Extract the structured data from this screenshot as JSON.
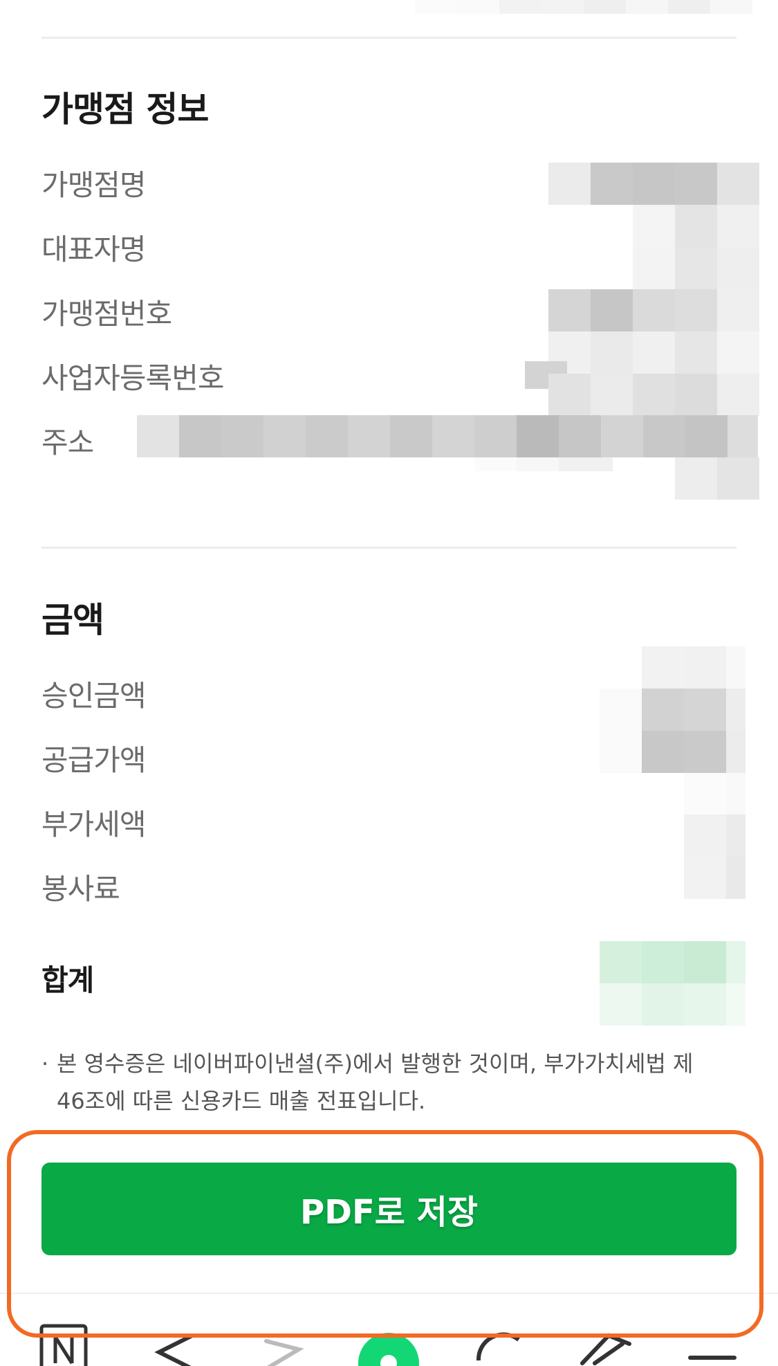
{
  "merchant_section": {
    "title": "가맹점 정보",
    "rows": [
      {
        "label": "가맹점명"
      },
      {
        "label": "대표자명"
      },
      {
        "label": "가맹점번호"
      },
      {
        "label": "사업자등록번호"
      },
      {
        "label": "주소"
      }
    ]
  },
  "amount_section": {
    "title": "금액",
    "rows": [
      {
        "label": "승인금액"
      },
      {
        "label": "공급가액"
      },
      {
        "label": "부가세액"
      },
      {
        "label": "봉사료"
      }
    ],
    "total_label": "합계"
  },
  "note": {
    "bullet": "·",
    "text": "본 영수증은 네이버파이낸셜(주)에서 발행한 것이며, 부가가치세법 제 46조에 따른 신용카드 매출 전표입니다."
  },
  "actions": {
    "save_pdf_label": "PDF로 저장"
  },
  "colors": {
    "accent_green": "#09aa46",
    "highlight_orange": "#f26a23",
    "label_gray": "#6b6b6b"
  },
  "bottom_bar": {
    "items": [
      "home-icon",
      "back-arrow-icon",
      "forward-arrow-icon",
      "green-dot-icon",
      "refresh-icon",
      "share-icon",
      "menu-icon"
    ]
  }
}
